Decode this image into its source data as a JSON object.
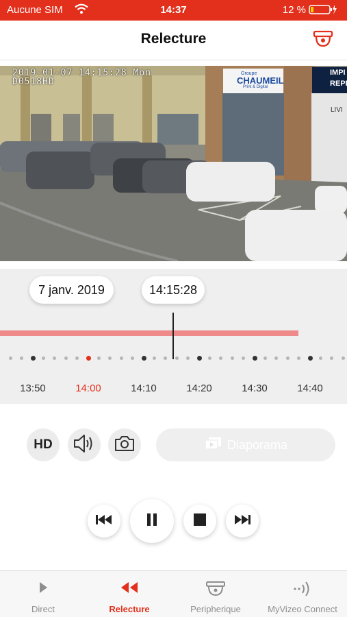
{
  "status_bar": {
    "carrier": "Aucune SIM",
    "time": "14:37",
    "battery": "12 %"
  },
  "header": {
    "title": "Relecture",
    "camera_icon": "camera-dome-icon"
  },
  "video": {
    "osd_timestamp": "2019-01-07 14:15:28 Mon",
    "osd_camera_id": "D0518HD",
    "signage": {
      "store_small": "Groupe",
      "store_name": "CHAUMEIL",
      "store_sub": "Print & Digital",
      "imp_line1": "IMPI",
      "imp_line2": "REPRO",
      "livr": "LIVI"
    }
  },
  "timeline": {
    "date": "7 janv. 2019",
    "time": "14:15:28",
    "labels": [
      "13:50",
      "14:00",
      "14:10",
      "14:20",
      "14:30",
      "14:40"
    ],
    "active_label": "14:00",
    "recording_fraction": 0.86
  },
  "controls": {
    "hd_label": "HD",
    "diaporama_label": "Diaporama"
  },
  "tabs": [
    {
      "label": "Direct",
      "icon": "play-icon",
      "active": false
    },
    {
      "label": "Relecture",
      "icon": "rewind-icon",
      "active": true
    },
    {
      "label": "Peripherique",
      "icon": "camera-dome-icon",
      "active": false
    },
    {
      "label": "MyVizeo Connect",
      "icon": "signal-icon",
      "active": false
    }
  ],
  "colors": {
    "accent": "#e2301c",
    "recording_bar": "#ef8a8a"
  }
}
